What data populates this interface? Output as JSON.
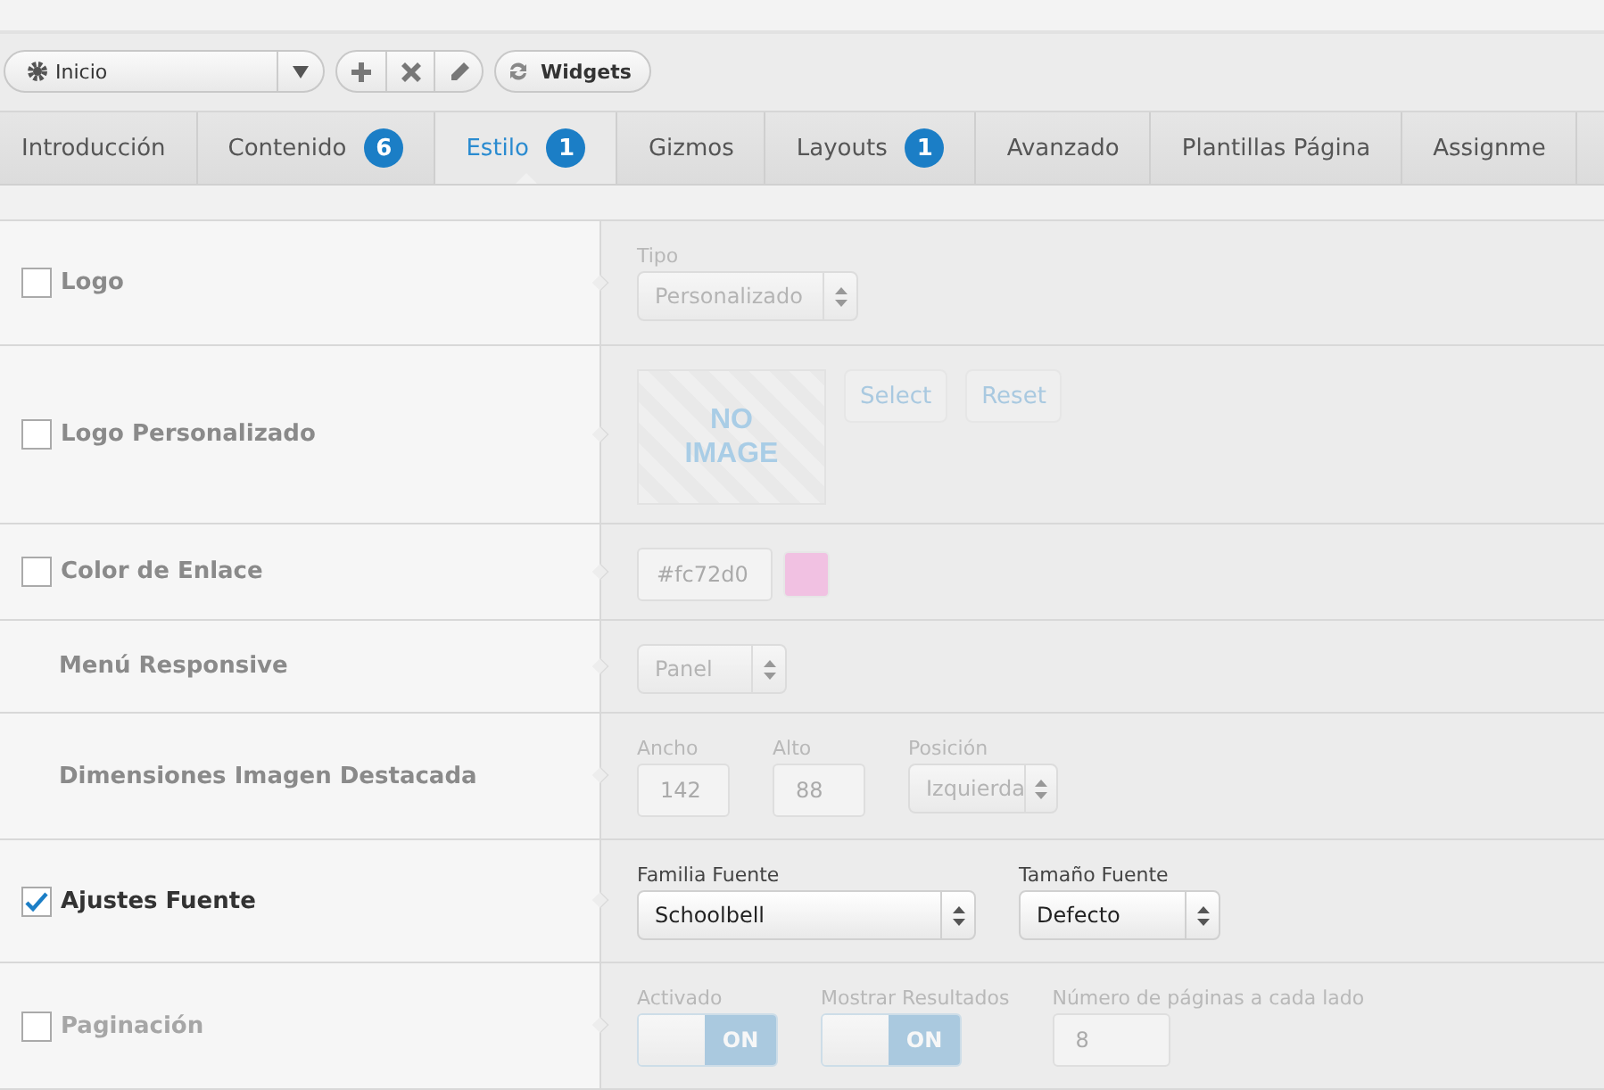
{
  "toolbar": {
    "preset": "Inicio",
    "actions": [
      {
        "kind": "add"
      },
      {
        "kind": "delete"
      },
      {
        "kind": "edit"
      }
    ],
    "widgets": "Widgets"
  },
  "tabs": [
    {
      "label": "Introducción",
      "selected": false
    },
    {
      "label": "Contenido",
      "badge": "6",
      "selected": false
    },
    {
      "label": "Estilo",
      "badge": "1",
      "selected": true
    },
    {
      "label": "Gizmos",
      "selected": false
    },
    {
      "label": "Layouts",
      "badge": "1",
      "selected": false
    },
    {
      "label": "Avanzado",
      "selected": false
    },
    {
      "label": "Plantillas Página",
      "selected": false
    },
    {
      "label": "Assignme",
      "selected": false
    }
  ],
  "rows": [
    {
      "label": "Logo",
      "kind": "checkbox",
      "checked": false,
      "enabled": false,
      "controls": [
        {
          "kind": "select",
          "label": "Tipo",
          "value": "Personalizado"
        }
      ]
    },
    {
      "label": "Logo Personalizado",
      "kind": "checkbox",
      "checked": false,
      "enabled": false,
      "controls": [
        {
          "kind": "image",
          "text": "NO IMAGE"
        },
        {
          "kind": "button",
          "text": "Select"
        },
        {
          "kind": "button",
          "text": "Reset"
        }
      ]
    },
    {
      "label": "Color de Enlace",
      "kind": "checkbox",
      "checked": false,
      "enabled": false,
      "controls": [
        {
          "kind": "color",
          "value": "#fc72d0"
        }
      ]
    },
    {
      "label": "Menú Responsive",
      "kind": "plain",
      "enabled": false,
      "controls": [
        {
          "kind": "select",
          "value": "Panel"
        }
      ]
    },
    {
      "label": "Dimensiones Imagen Destacada",
      "kind": "plain",
      "enabled": false,
      "controls": [
        {
          "kind": "number",
          "label": "Ancho",
          "value": "142"
        },
        {
          "kind": "number",
          "label": "Alto",
          "value": "88"
        },
        {
          "kind": "select",
          "label": "Posición",
          "value": "Izquierda"
        }
      ]
    },
    {
      "label": "Ajustes Fuente",
      "kind": "checkbox",
      "checked": true,
      "enabled": true,
      "controls": [
        {
          "kind": "select",
          "label": "Familia Fuente",
          "value": "Schoolbell"
        },
        {
          "kind": "select",
          "label": "Tamaño Fuente",
          "value": "Defecto"
        }
      ]
    },
    {
      "label": "Paginación",
      "kind": "checkbox",
      "checked": false,
      "enabled": false,
      "controls": [
        {
          "kind": "toggle",
          "label": "Activado",
          "on": true,
          "text": "ON"
        },
        {
          "kind": "toggle",
          "label": "Mostrar Resultados",
          "on": true,
          "text": "ON"
        },
        {
          "kind": "number",
          "label": "Número de páginas a cada lado",
          "value": "8"
        }
      ]
    }
  ]
}
